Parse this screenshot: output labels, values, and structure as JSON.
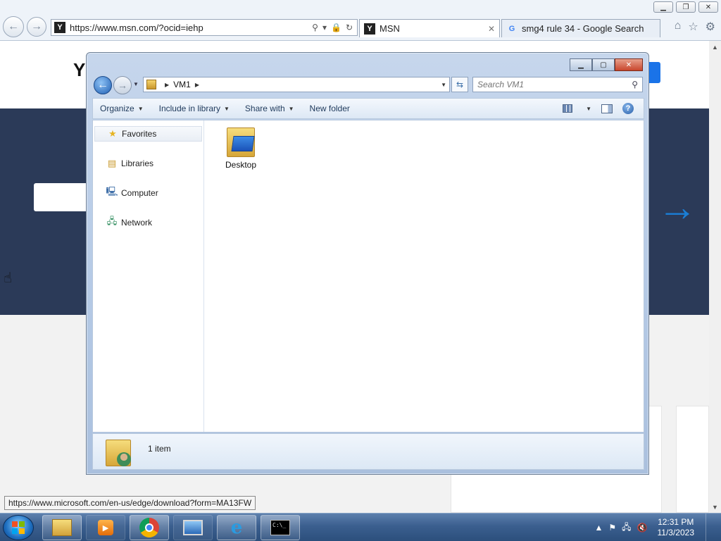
{
  "browser": {
    "address_url": "https://www.msn.com/?ocid=iehp",
    "tabs": [
      {
        "label": "MSN",
        "favicon": "msn-logo-icon"
      },
      {
        "label": "smg4 rule 34 - Google Search",
        "favicon": "google-icon"
      }
    ],
    "status_tooltip": "https://www.microsoft.com/en-us/edge/download?form=MA13FW"
  },
  "explorer": {
    "breadcrumb": [
      "VM1"
    ],
    "search_placeholder": "Search VM1",
    "toolbar": {
      "organize": "Organize",
      "include_in_library": "Include in library",
      "share_with": "Share with",
      "new_folder": "New folder"
    },
    "nav": {
      "favorites": "Favorites",
      "libraries": "Libraries",
      "computer": "Computer",
      "network": "Network"
    },
    "items": [
      {
        "label": "Desktop",
        "icon": "desktop-folder-icon"
      }
    ],
    "details": {
      "count_text": "1 item"
    }
  },
  "taskbar": {
    "clock_time": "12:31 PM",
    "clock_date": "11/3/2023",
    "apps": [
      "windows-explorer",
      "windows-media-player",
      "google-chrome",
      "remote-desktop",
      "internet-explorer",
      "command-prompt"
    ]
  },
  "colors": {
    "page_band": "#2b3a58",
    "taskbar": "#3b5f8f",
    "accent_blue": "#1a7fd6"
  }
}
